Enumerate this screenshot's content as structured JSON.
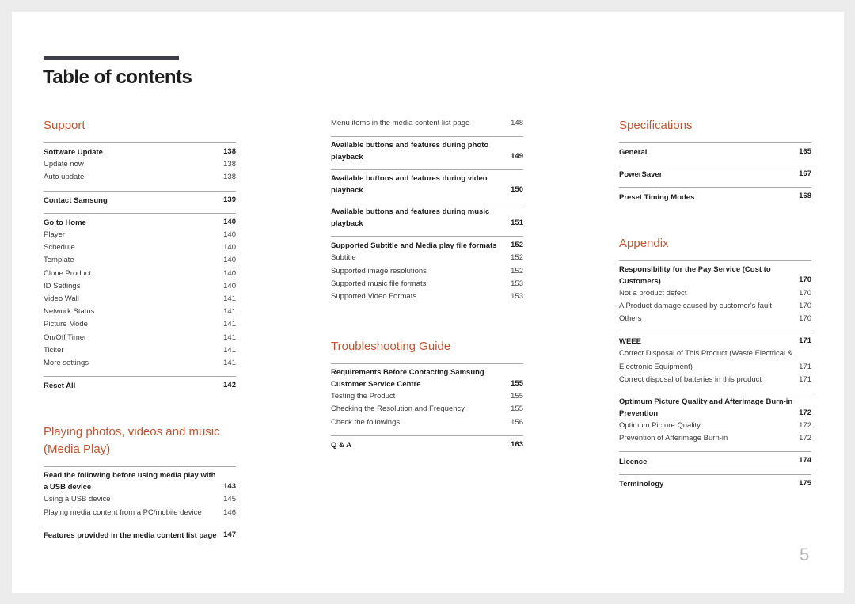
{
  "page_title": "Table of contents",
  "page_number": "5",
  "accent_color": "#c9522e",
  "columns": [
    {
      "sections": [
        {
          "title": "Support",
          "groups": [
            {
              "heading": "Software Update",
              "page": "138",
              "items": [
                {
                  "label": "Update now",
                  "page": "138"
                },
                {
                  "label": "Auto update",
                  "page": "138"
                }
              ]
            },
            {
              "heading": "Contact Samsung",
              "page": "139",
              "items": []
            },
            {
              "heading": "Go to Home",
              "page": "140",
              "items": [
                {
                  "label": "Player",
                  "page": "140"
                },
                {
                  "label": "Schedule",
                  "page": "140"
                },
                {
                  "label": "Template",
                  "page": "140"
                },
                {
                  "label": "Clone Product",
                  "page": "140"
                },
                {
                  "label": "ID Settings",
                  "page": "140"
                },
                {
                  "label": "Video Wall",
                  "page": "141"
                },
                {
                  "label": "Network Status",
                  "page": "141"
                },
                {
                  "label": "Picture Mode",
                  "page": "141"
                },
                {
                  "label": "On/Off Timer",
                  "page": "141"
                },
                {
                  "label": "Ticker",
                  "page": "141"
                },
                {
                  "label": "More settings",
                  "page": "141"
                }
              ]
            },
            {
              "heading": "Reset All",
              "page": "142",
              "items": []
            }
          ]
        },
        {
          "title": "Playing photos, videos and music (Media Play)",
          "groups": [
            {
              "heading": "Read the following before using media play with a USB device",
              "page": "143",
              "items": [
                {
                  "label": "Using a USB device",
                  "page": "145"
                },
                {
                  "label": "Playing media content from a PC/mobile device",
                  "page": "146"
                }
              ]
            },
            {
              "heading": "Features provided in the media content list page",
              "page": "147",
              "items": []
            }
          ]
        }
      ]
    },
    {
      "sections": [
        {
          "title": "",
          "groups": [
            {
              "heading": "",
              "page": "",
              "items": [
                {
                  "label": "Menu items in the media content list page",
                  "page": "148"
                }
              ]
            },
            {
              "heading": "Available buttons and features during photo playback",
              "page": "149",
              "items": []
            },
            {
              "heading": "Available buttons and features during video playback",
              "page": "150",
              "items": []
            },
            {
              "heading": "Available buttons and features during music playback",
              "page": "151",
              "items": []
            },
            {
              "heading": "Supported Subtitle and Media play file formats",
              "page": "152",
              "items": [
                {
                  "label": "Subtitle",
                  "page": "152"
                },
                {
                  "label": "Supported image resolutions",
                  "page": "152"
                },
                {
                  "label": "Supported music file formats",
                  "page": "153"
                },
                {
                  "label": "Supported Video Formats",
                  "page": "153"
                }
              ]
            }
          ]
        },
        {
          "title": "Troubleshooting Guide",
          "groups": [
            {
              "heading": "Requirements Before Contacting Samsung Customer Service Centre",
              "page": "155",
              "items": [
                {
                  "label": "Testing the Product",
                  "page": "155"
                },
                {
                  "label": "Checking the Resolution and Frequency",
                  "page": "155"
                },
                {
                  "label": "Check the followings.",
                  "page": "156"
                }
              ]
            },
            {
              "heading": "Q & A",
              "page": "163",
              "items": []
            }
          ]
        }
      ]
    },
    {
      "sections": [
        {
          "title": "Specifications",
          "groups": [
            {
              "heading": "General",
              "page": "165",
              "items": []
            },
            {
              "heading": "PowerSaver",
              "page": "167",
              "items": []
            },
            {
              "heading": "Preset Timing Modes",
              "page": "168",
              "items": []
            }
          ]
        },
        {
          "title": "Appendix",
          "groups": [
            {
              "heading": "Responsibility for the Pay Service (Cost to Customers)",
              "page": "170",
              "items": [
                {
                  "label": "Not a product defect",
                  "page": "170"
                },
                {
                  "label": "A Product damage caused by customer's fault",
                  "page": "170"
                },
                {
                  "label": "Others",
                  "page": "170"
                }
              ]
            },
            {
              "heading": "WEEE",
              "page": "171",
              "items": [
                {
                  "label": "Correct Disposal of This Product (Waste Electrical & Electronic Equipment)",
                  "page": "171"
                },
                {
                  "label": "Correct disposal of batteries in this product",
                  "page": "171"
                }
              ]
            },
            {
              "heading": "Optimum Picture Quality and Afterimage Burn-in Prevention",
              "page": "172",
              "items": [
                {
                  "label": "Optimum Picture Quality",
                  "page": "172"
                },
                {
                  "label": "Prevention of Afterimage Burn-in",
                  "page": "172"
                }
              ]
            },
            {
              "heading": "Licence",
              "page": "174",
              "items": []
            },
            {
              "heading": "Terminology",
              "page": "175",
              "items": []
            }
          ]
        }
      ]
    }
  ]
}
